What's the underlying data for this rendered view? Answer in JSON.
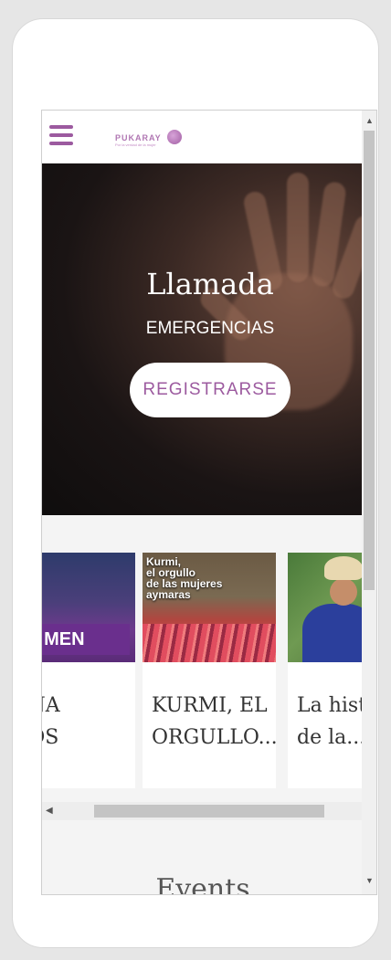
{
  "header": {
    "logo_text": "PUKARAY",
    "logo_tagline": "Por la verdad de la mujer"
  },
  "hero": {
    "title": "Llamada",
    "subtitle": "EMERGENCIAS",
    "button_label": "REGISTRARSE"
  },
  "cards": [
    {
      "title": "UNA\nNOS",
      "image_caption": "UNA MEN"
    },
    {
      "title": "KURMI, EL\nORGULLO...",
      "image_caption": "Kurmi,\nel orgullo\nde las mujeres\naymaras"
    },
    {
      "title": "La histo\nde la...",
      "image_caption": ""
    }
  ],
  "sections": {
    "events_heading": "Events"
  },
  "colors": {
    "accent": "#9c5a9f",
    "page_bg": "#f4f4f4"
  }
}
